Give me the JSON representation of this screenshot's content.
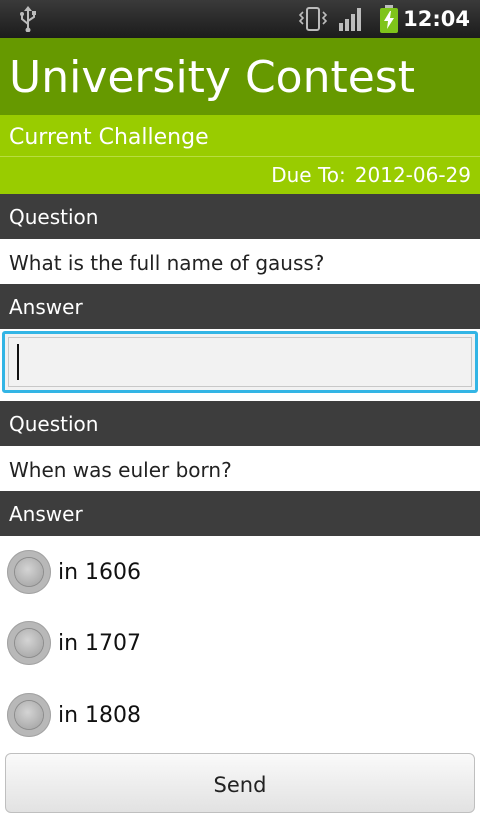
{
  "status_bar": {
    "time": "12:04",
    "icons": [
      "usb-icon",
      "vibrate-icon",
      "signal-icon",
      "battery-charging-icon"
    ]
  },
  "app": {
    "title": "University Contest"
  },
  "challenge": {
    "title": "Current Challenge",
    "due_label": "Due To:",
    "due_date": "2012-06-29"
  },
  "questions": [
    {
      "header": "Question",
      "text": "What is the full name of  gauss?",
      "answer_header": "Answer",
      "answer_value": ""
    },
    {
      "header": "Question",
      "text": "When was euler born?",
      "answer_header": "Answer",
      "options": [
        "in 1606",
        "in 1707",
        "in 1808"
      ]
    }
  ],
  "send_label": "Send",
  "colors": {
    "title_bar": "#669900",
    "challenge_bar": "#99cc00",
    "section_header": "#3d3d3d",
    "focus_border": "#33b5e5"
  }
}
